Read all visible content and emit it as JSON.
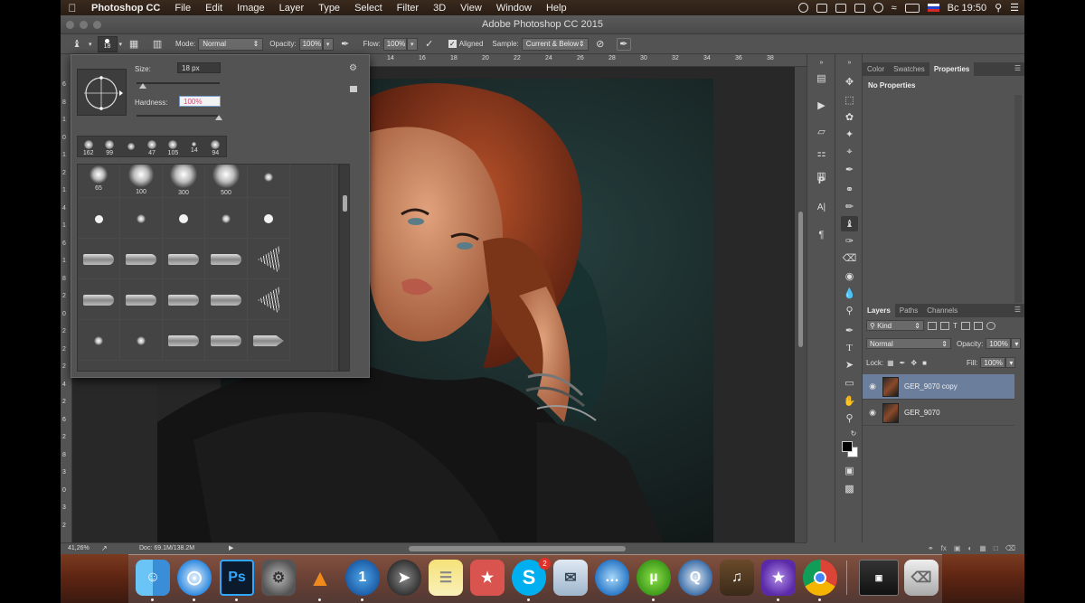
{
  "menubar": {
    "apple": "",
    "items": [
      "Photoshop CC",
      "File",
      "Edit",
      "Image",
      "Layer",
      "Type",
      "Select",
      "Filter",
      "3D",
      "View",
      "Window",
      "Help"
    ],
    "clock": "Вс 19:50"
  },
  "window": {
    "title": "Adobe Photoshop CC 2015"
  },
  "options_bar": {
    "brush_size": "18",
    "mode_label": "Mode:",
    "mode_value": "Normal",
    "opacity_label": "Opacity:",
    "opacity_value": "100%",
    "flow_label": "Flow:",
    "flow_value": "100%",
    "aligned_label": "Aligned",
    "aligned_checked": true,
    "sample_label": "Sample:",
    "sample_value": "Current & Below"
  },
  "rulers": {
    "top": [
      "14",
      "16",
      "18",
      "20",
      "22",
      "24",
      "26",
      "28",
      "30",
      "32",
      "34",
      "36",
      "38"
    ],
    "left": [
      "6",
      "8",
      "1",
      "0",
      "1",
      "2",
      "1",
      "4",
      "1",
      "6",
      "1",
      "8",
      "2",
      "0",
      "2",
      "2",
      "2",
      "4",
      "2",
      "6",
      "2",
      "8",
      "3",
      "0",
      "3",
      "2"
    ]
  },
  "brush_popup": {
    "size_label": "Size:",
    "size_value": "18 px",
    "hardness_label": "Hardness:",
    "hardness_value": "100%",
    "recent": [
      "162",
      "99",
      "",
      "47",
      "105",
      "14",
      "94"
    ],
    "presets_row1": [
      "65",
      "100",
      "300",
      "500",
      ""
    ]
  },
  "status": {
    "zoom": "41,26%",
    "doc": "Doc: 69.1M/138.2M"
  },
  "panels": {
    "top_tabs": [
      "Color",
      "Swatches",
      "Properties"
    ],
    "properties_text": "No Properties",
    "layer_tabs": [
      "Layers",
      "Paths",
      "Channels"
    ],
    "filter_kind": "Kind",
    "blend_mode": "Normal",
    "opacity_label": "Opacity:",
    "opacity_value": "100%",
    "lock_label": "Lock:",
    "fill_label": "Fill:",
    "fill_value": "100%",
    "layers": [
      {
        "name": "GER_9070 copy",
        "selected": true
      },
      {
        "name": "GER_9070",
        "selected": false
      }
    ]
  },
  "dock": {
    "items": [
      "finder-icon",
      "safari-icon",
      "photoshop-icon",
      "system-preferences-icon",
      "vlc-icon",
      "1password-icon",
      "launchpad-icon",
      "notes-icon",
      "wunderlist-icon",
      "skype-icon",
      "mail-icon",
      "messages-icon",
      "utorrent-icon",
      "quicktime-icon",
      "garageband-icon",
      "imovie-icon",
      "chrome-icon",
      "screenshot-icon",
      "trash-icon"
    ],
    "ps_label": "Ps",
    "skype_label": "S",
    "skype_badge": "2"
  },
  "colors": {
    "accent_selection": "#6b7e9c",
    "hardness_text": "#e0457b"
  }
}
